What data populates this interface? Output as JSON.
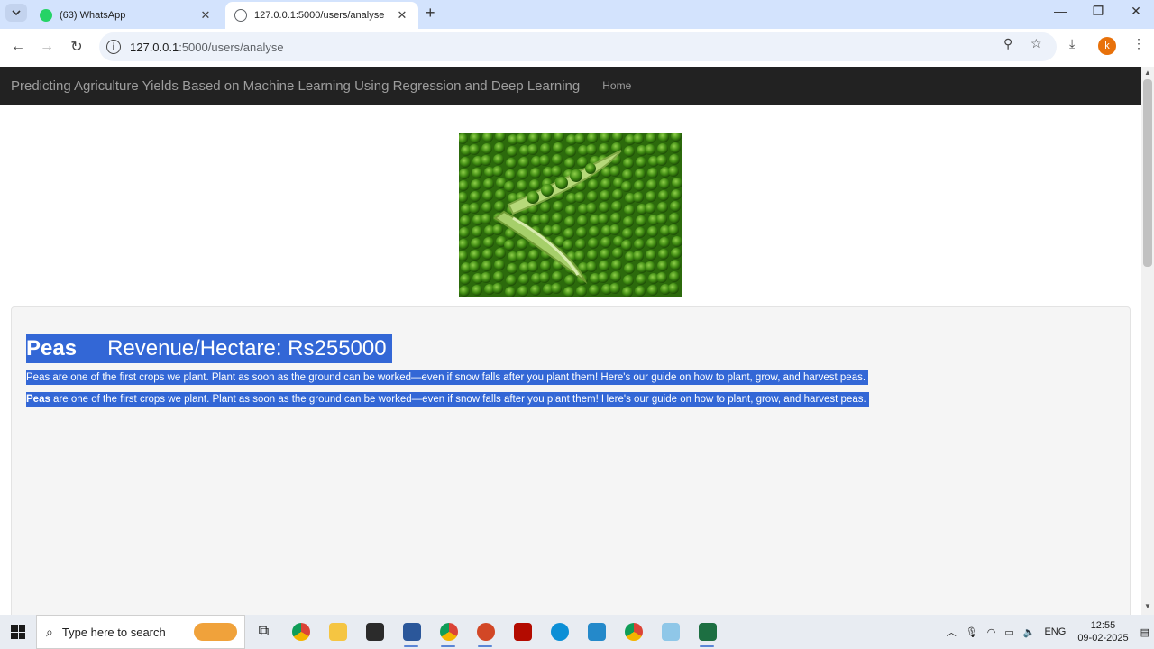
{
  "browser": {
    "tabs": [
      {
        "title": "(63) WhatsApp",
        "icon": "whatsapp-icon",
        "active": false
      },
      {
        "title": "127.0.0.1:5000/users/analyse",
        "icon": "globe-icon",
        "active": true
      }
    ],
    "url_host": "127.0.0.1",
    "url_path": ":5000/users/analyse",
    "profile_initial": "k"
  },
  "page": {
    "brand": "Predicting Agriculture Yields Based on Machine Learning Using Regression and Deep Learning",
    "nav_home": "Home",
    "crop_name": "Peas",
    "revenue_text": "Revenue/Hectare: Rs255000",
    "description_1": "Peas are one of the first crops we plant. Plant as soon as the ground can be worked—even if snow falls after you plant them!  Here's our guide on how to plant, grow, and harvest peas.",
    "description_2_bold": "Peas",
    "description_2_rest": " are one of the first crops we plant. Plant as soon as the ground can be worked—even if snow falls after you plant them!  Here's our guide on how to plant, grow, and harvest peas.",
    "image": "green-peas-photo"
  },
  "taskbar": {
    "search_placeholder": "Type here to search",
    "apps": [
      "task-view-icon",
      "chrome-icon",
      "file-explorer-icon",
      "terminal-icon",
      "word-icon",
      "chrome-icon",
      "powerpoint-icon",
      "acrobat-icon",
      "edge-icon",
      "vscode-icon",
      "chrome-icon",
      "notepad-icon",
      "excel-icon"
    ],
    "language": "ENG",
    "time": "12:55",
    "date": "09-02-2025"
  },
  "colors": {
    "navbar": "#222222",
    "selection": "#3367d6",
    "well": "#f5f5f5"
  }
}
